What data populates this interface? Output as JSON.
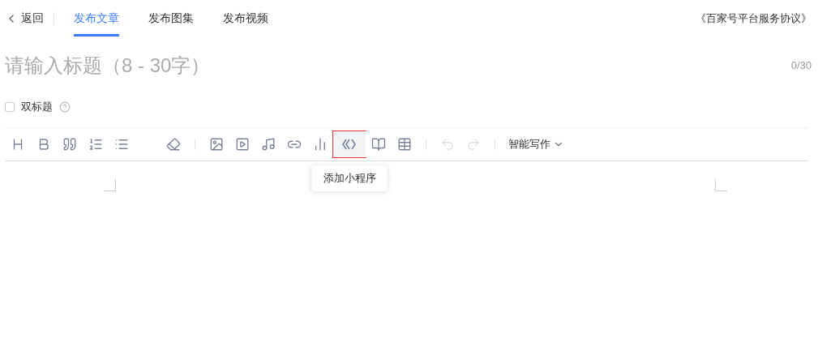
{
  "header": {
    "back": {
      "label": "返回"
    },
    "tabs": [
      {
        "label": "发布文章",
        "selected": true
      },
      {
        "label": "发布图集",
        "selected": false
      },
      {
        "label": "发布视频",
        "selected": false
      }
    ],
    "agreement_link": "《百家号平台服务协议》"
  },
  "title_field": {
    "placeholder": "请输入标题（8 - 30字）",
    "counter": "0/30"
  },
  "double_title": {
    "label": "双标题",
    "checked": false
  },
  "toolbar": {
    "groups": [
      [
        {
          "kind": "heading",
          "disabled": false,
          "highlighted": false
        },
        {
          "kind": "bold",
          "disabled": false,
          "highlighted": false
        },
        {
          "kind": "quote",
          "disabled": false,
          "highlighted": false
        },
        {
          "kind": "ordered",
          "disabled": false,
          "highlighted": false
        },
        {
          "kind": "bullets",
          "disabled": false,
          "highlighted": false
        },
        {
          "kind": "eraser",
          "disabled": false,
          "highlighted": false
        }
      ],
      [
        {
          "kind": "image",
          "disabled": false,
          "highlighted": false
        },
        {
          "kind": "video",
          "disabled": false,
          "highlighted": false
        },
        {
          "kind": "music",
          "disabled": false,
          "highlighted": false
        },
        {
          "kind": "link",
          "disabled": false,
          "highlighted": false
        },
        {
          "kind": "chart",
          "disabled": false,
          "highlighted": false
        },
        {
          "kind": "miniprogram",
          "disabled": false,
          "highlighted": true
        },
        {
          "kind": "book",
          "disabled": false,
          "highlighted": false
        },
        {
          "kind": "table",
          "disabled": false,
          "highlighted": false
        }
      ],
      [
        {
          "kind": "undo",
          "disabled": true,
          "highlighted": false
        },
        {
          "kind": "redo",
          "disabled": true,
          "highlighted": false
        }
      ]
    ],
    "ai_menu": {
      "label": "智能写作"
    },
    "tooltip": "添加小程序"
  }
}
